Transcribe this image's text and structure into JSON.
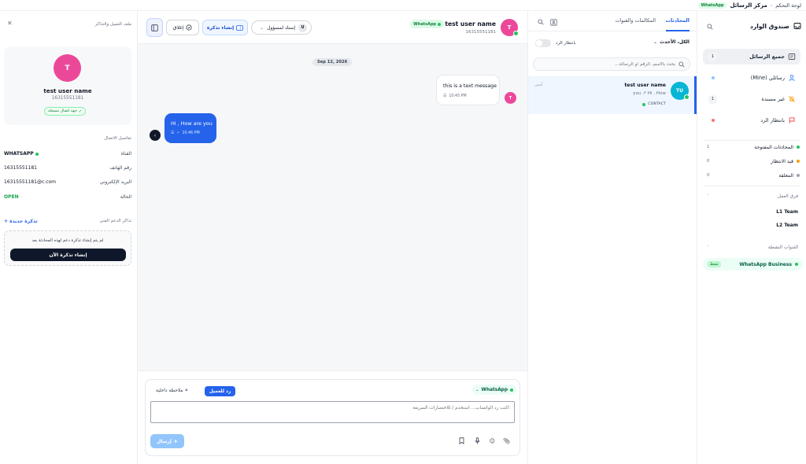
{
  "topbar": {
    "app_title": "مركز الرسائل",
    "dashboard_link": "لوحة التحكم",
    "channel_badge": "WhatsApp"
  },
  "nav": {
    "title": "صندوق الوارد",
    "items": [
      {
        "label": "جميع الرسائل",
        "count": "1"
      },
      {
        "label": "رسائلي (Mine)",
        "count": ""
      },
      {
        "label": "غير مسندة",
        "count": "1"
      },
      {
        "label": "بانتظار الرد",
        "count": ""
      }
    ],
    "statuses": [
      {
        "label": "المحادثات المفتوحة",
        "count": "1",
        "color": "#22c55e"
      },
      {
        "label": "قيد الانتظار",
        "count": "0",
        "color": "#f59e0b"
      },
      {
        "label": "المغلقة",
        "count": "0",
        "color": "#9ca3af"
      }
    ],
    "teams_header": "فرق العمل",
    "teams": [
      "L1 Team",
      "L2 Team"
    ],
    "channels_header": "القنوات النشطة",
    "channels": [
      {
        "label": "WhatsApp Business",
        "badge": "نشط"
      }
    ]
  },
  "convlist": {
    "tabs": [
      "المحادثات",
      "المكالمات والقنوات"
    ],
    "filter_label": "الكل، الأحدث",
    "toggle_label": "بانتظار الرد",
    "search_placeholder": "بحث بالاسم، الرقم أو الرسالة...",
    "items": [
      {
        "name": "test user name",
        "time": "أمس",
        "preview": "you ↗ Hi , How",
        "tag": "CONTACT",
        "initials": "TU"
      }
    ]
  },
  "chat": {
    "contact_name": "test user name",
    "contact_phone": "16315551181",
    "channel": "WhatsApp",
    "avatar_letter": "T",
    "assign_label": "إسناد لمسؤول",
    "assign_avatar": "U",
    "create_ticket_label": "إنشاء تذكرة",
    "close_label": "إغلاق",
    "date_chip": "Sep 12, 2026",
    "messages": [
      {
        "text": "this is a text message",
        "time": "10:45 PM",
        "direction": "in"
      },
      {
        "text": "Hi , How are you",
        "time": "10:46 PM",
        "direction": "out"
      }
    ],
    "composer": {
      "channel": "WhatsApp",
      "reply_tab": "رد للعميل",
      "note_tab": "ملاحظة داخلية",
      "placeholder": "اكتب رد الواتساب... استخدم / للاختصارات السريعة",
      "send_label": "إرسال"
    }
  },
  "details": {
    "panel_title": "ملف العميل والتذاكر",
    "avatar_letter": "T",
    "name": "test user name",
    "phone": "16315551181",
    "badge": "جهة اتصال مسجلة",
    "section_title": "تفاصيل الاتصال",
    "fields": [
      {
        "label": "القناة",
        "value": "WHATSAPP"
      },
      {
        "label": "رقم الهاتف",
        "value": "16315551181"
      },
      {
        "label": "البريد الإلكتروني",
        "value": "16315551181@c.com"
      },
      {
        "label": "الحالة",
        "value": "OPEN"
      }
    ],
    "tickets_title": "تذاكر الدعم الفني",
    "new_ticket_link": "تذكرة جديدة +",
    "empty_text": "لم يتم إنشاء تذكرة دعم لهذه المحادثة بعد",
    "create_now_button": "إنشاء تذكرة الآن"
  }
}
